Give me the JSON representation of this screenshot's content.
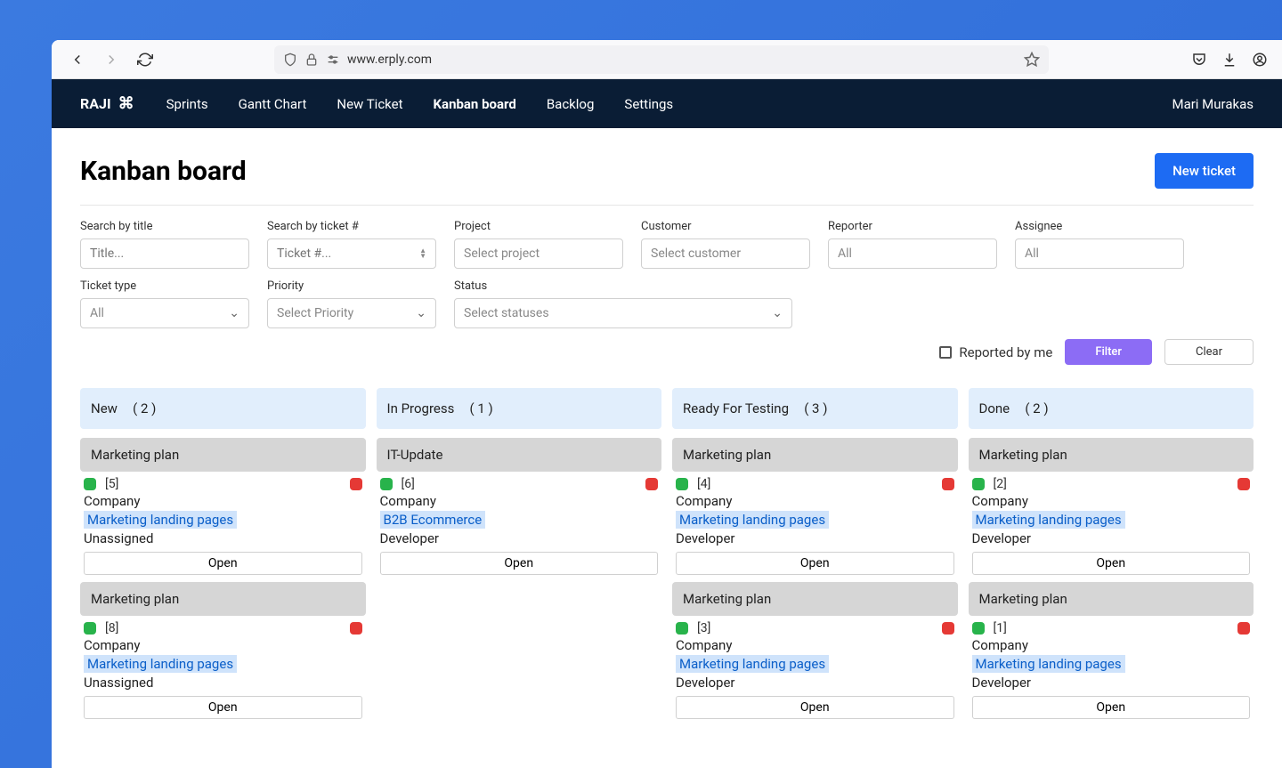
{
  "browser": {
    "url": "www.erply.com"
  },
  "header": {
    "brand": "RAJI",
    "nav": [
      {
        "label": "Sprints",
        "active": false
      },
      {
        "label": "Gantt Chart",
        "active": false
      },
      {
        "label": "New Ticket",
        "active": false
      },
      {
        "label": "Kanban board",
        "active": true
      },
      {
        "label": "Backlog",
        "active": false
      },
      {
        "label": "Settings",
        "active": false
      }
    ],
    "user": "Mari Murakas"
  },
  "page": {
    "title": "Kanban board",
    "new_ticket_label": "New ticket"
  },
  "filters": {
    "search_title": {
      "label": "Search by title",
      "placeholder": "Title..."
    },
    "search_ticket": {
      "label": "Search by ticket #",
      "placeholder": "Ticket #..."
    },
    "project": {
      "label": "Project",
      "placeholder": "Select project"
    },
    "customer": {
      "label": "Customer",
      "placeholder": "Select customer"
    },
    "reporter": {
      "label": "Reporter",
      "placeholder": "All"
    },
    "assignee": {
      "label": "Assignee",
      "placeholder": "All"
    },
    "ticket_type": {
      "label": "Ticket type",
      "value": "All"
    },
    "priority": {
      "label": "Priority",
      "value": "Select Priority"
    },
    "status": {
      "label": "Status",
      "value": "Select statuses"
    },
    "reported_by_me": "Reported by me",
    "filter_btn": "Filter",
    "clear_btn": "Clear"
  },
  "columns": [
    {
      "name": "New",
      "count": "( 2 )",
      "cards": [
        {
          "title": "Marketing plan",
          "id": "[5]",
          "company": "Company",
          "link": "Marketing landing pages",
          "assignee": "Unassigned",
          "open": "Open"
        },
        {
          "title": "Marketing plan",
          "id": "[8]",
          "company": "Company",
          "link": "Marketing landing pages",
          "assignee": "Unassigned",
          "open": "Open"
        }
      ]
    },
    {
      "name": "In Progress",
      "count": "( 1 )",
      "cards": [
        {
          "title": "IT-Update",
          "id": "[6]",
          "company": "Company",
          "link": "B2B Ecommerce",
          "assignee": "Developer",
          "open": "Open"
        }
      ]
    },
    {
      "name": "Ready For Testing",
      "count": "( 3 )",
      "cards": [
        {
          "title": "Marketing plan",
          "id": "[4]",
          "company": "Company",
          "link": "Marketing landing pages",
          "assignee": "Developer",
          "open": "Open"
        },
        {
          "title": "Marketing plan",
          "id": "[3]",
          "company": "Company",
          "link": "Marketing landing pages",
          "assignee": "Developer",
          "open": "Open"
        }
      ]
    },
    {
      "name": "Done",
      "count": "( 2 )",
      "cards": [
        {
          "title": "Marketing plan",
          "id": "[2]",
          "company": "Company",
          "link": "Marketing landing pages",
          "assignee": "Developer",
          "open": "Open"
        },
        {
          "title": "Marketing plan",
          "id": "[1]",
          "company": "Company",
          "link": "Marketing landing pages",
          "assignee": "Developer",
          "open": "Open"
        }
      ]
    }
  ]
}
